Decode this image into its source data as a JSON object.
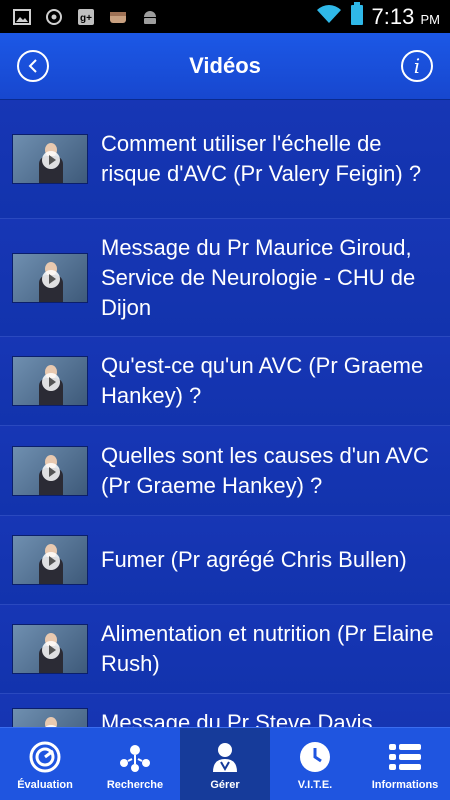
{
  "status_bar": {
    "time": "7:13",
    "ampm": "PM",
    "left_icons": [
      "image-icon",
      "sync-icon",
      "google-plus-icon",
      "fist-icon",
      "android-icon"
    ],
    "right_icons": [
      "wifi-icon",
      "battery-icon"
    ]
  },
  "header": {
    "title": "Vidéos",
    "back_icon": "back-arrow-icon",
    "info_icon": "info-icon"
  },
  "videos": [
    {
      "title": "Comment utiliser l'échelle de risque d'AVC (Pr Valery Feigin) ?"
    },
    {
      "title": "Message du Pr Maurice Giroud, Service de Neurologie - CHU de Dijon"
    },
    {
      "title": "Qu'est-ce qu'un AVC (Pr Graeme Hankey) ?"
    },
    {
      "title": "Quelles sont les causes d'un AVC (Pr Graeme Hankey) ?"
    },
    {
      "title": "Fumer (Pr agrégé Chris Bullen)"
    },
    {
      "title": "Alimentation et nutrition (Pr Elaine Rush)"
    },
    {
      "title": "Message du Pr Steve Davis"
    }
  ],
  "bottom_nav": [
    {
      "label": "Évaluation",
      "icon": "gauge-icon",
      "active": false
    },
    {
      "label": "Recherche",
      "icon": "people-network-icon",
      "active": false
    },
    {
      "label": "Gérer",
      "icon": "doctor-icon",
      "active": true
    },
    {
      "label": "V.I.T.E.",
      "icon": "clock-icon",
      "active": false
    },
    {
      "label": "Informations",
      "icon": "list-icon",
      "active": false
    }
  ]
}
